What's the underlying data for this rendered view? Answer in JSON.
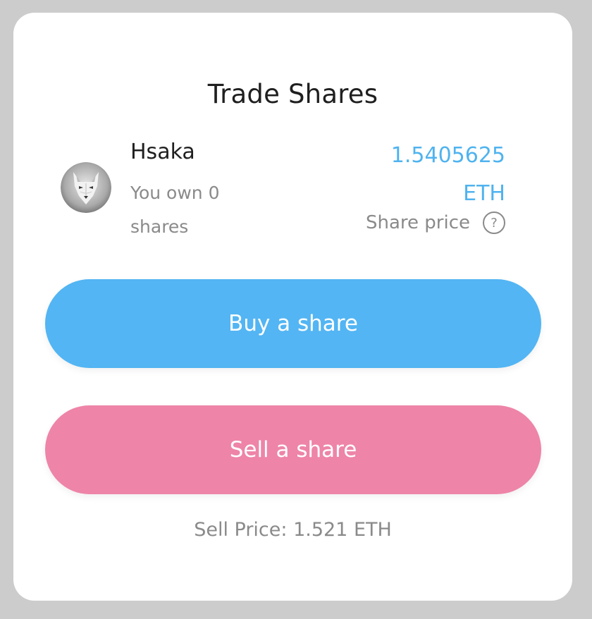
{
  "title": "Trade Shares",
  "user": {
    "name": "Hsaka",
    "own_text": "You own 0 shares",
    "avatar_icon": "wolf-avatar"
  },
  "price": {
    "value": "1.5405625 ETH",
    "label": "Share price",
    "help_icon": "help-circle-icon",
    "help_glyph": "?"
  },
  "actions": {
    "buy_label": "Buy a share",
    "sell_label": "Sell a share"
  },
  "sell_price_text": "Sell Price: 1.521 ETH",
  "colors": {
    "background": "#cccccc",
    "card": "#ffffff",
    "accent_blue": "#53b5f3",
    "price_blue": "#4fb3ef",
    "accent_pink": "#ee84a8",
    "muted_text": "#8a8a8a",
    "dark_text": "#1f1f1f"
  }
}
